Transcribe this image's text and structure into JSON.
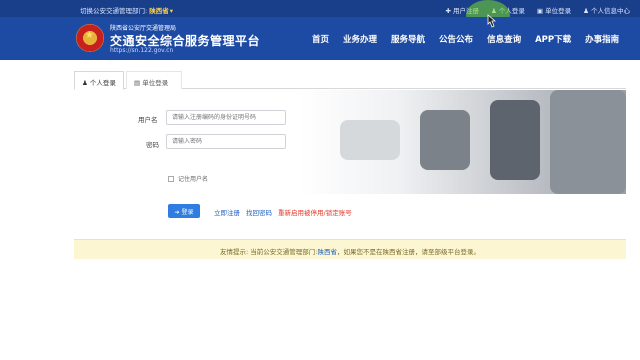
{
  "topbar": {
    "switch_label": "切换公安交通管理部门:",
    "province": "陕西省",
    "caret": "▾",
    "links": [
      "用户注册",
      "个人登录",
      "单位登录",
      "个人信息中心"
    ]
  },
  "header": {
    "subtitle": "陕西省公安厅交通管理局",
    "title": "交通安全综合服务管理平台",
    "url": "https://sn.122.gov.cn"
  },
  "nav": [
    "首页",
    "业务办理",
    "服务导航",
    "公告公布",
    "信息查询",
    "APP下载",
    "办事指南"
  ],
  "tabs": {
    "personal": "个人登录",
    "unit": "单位登录"
  },
  "form": {
    "user_label": "用户名",
    "user_placeholder": "请输入注册编码的身份证明号码",
    "pwd_label": "密码",
    "pwd_placeholder": "请输入密码",
    "remember_label": "记住用户名",
    "login_button": "登录"
  },
  "links": {
    "register": "立即注册",
    "forgot": "找回密码",
    "reactivate": "重新启用被停用/锁定账号"
  },
  "notice": {
    "prefix": "友情提示: 当前公安交通管理部门:",
    "province": "陕西省",
    "suffix": "，如果您不是在陕西省注册，请至部级平台登录。"
  },
  "icons": {
    "user_icon": "user-icon",
    "building_icon": "building-icon",
    "lock_icon": "lock-icon",
    "login_arrow_icon": "login-arrow-icon"
  },
  "colors": {
    "topbar": "#1a3f8a",
    "header": "#1d4aa3",
    "primary_button": "#2f7de1",
    "link_red": "#e0392b",
    "notice_bg": "#fcf6d2"
  }
}
